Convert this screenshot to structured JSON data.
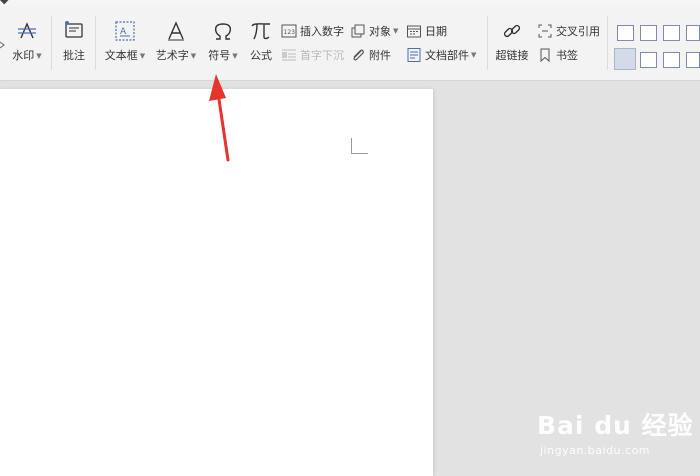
{
  "toolbar": {
    "watermark": "水印",
    "comment": "批注",
    "textbox": "文本框",
    "wordart": "艺术字",
    "symbol": "符号",
    "formula": "公式",
    "insert_number": "插入数字",
    "drop_cap": "首字下沉",
    "object": "对象",
    "attachment": "附件",
    "date": "日期",
    "doc_parts": "文档部件",
    "hyperlink": "超链接",
    "cross_reference": "交叉引用",
    "bookmark": "书签"
  },
  "watermark_overlay": {
    "brand": "Bai du 经验",
    "url": "jingyan.baidu.com"
  },
  "colors": {
    "ribbon_bg": "#f3f3f3",
    "workspace_bg": "#e2e2e2",
    "arrow": "#e8322c",
    "icon_blue": "#4a6fb5"
  }
}
